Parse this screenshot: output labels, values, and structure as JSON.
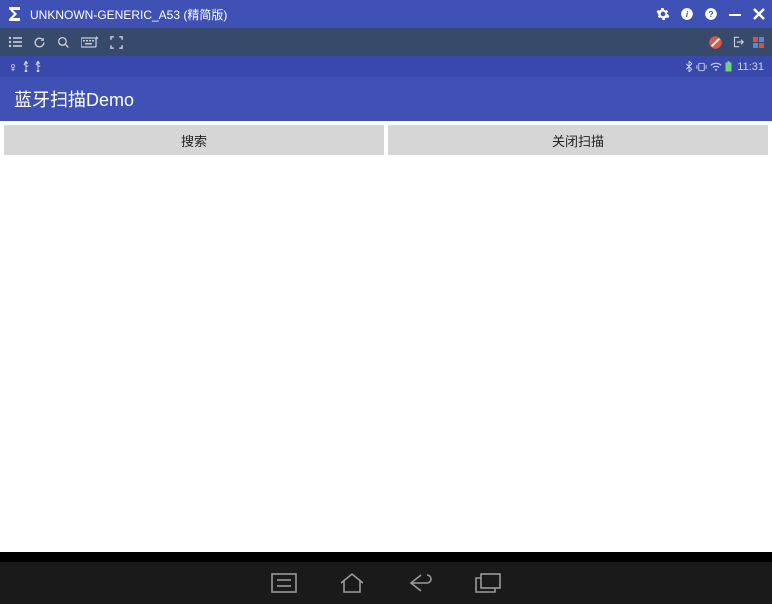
{
  "titlebar": {
    "title": "UNKNOWN-GENERIC_A53 (精简版)"
  },
  "statusbar": {
    "time": "11:31"
  },
  "appbar": {
    "title": "蓝牙扫描Demo"
  },
  "buttons": {
    "search": "搜索",
    "close_scan": "关闭扫描"
  }
}
